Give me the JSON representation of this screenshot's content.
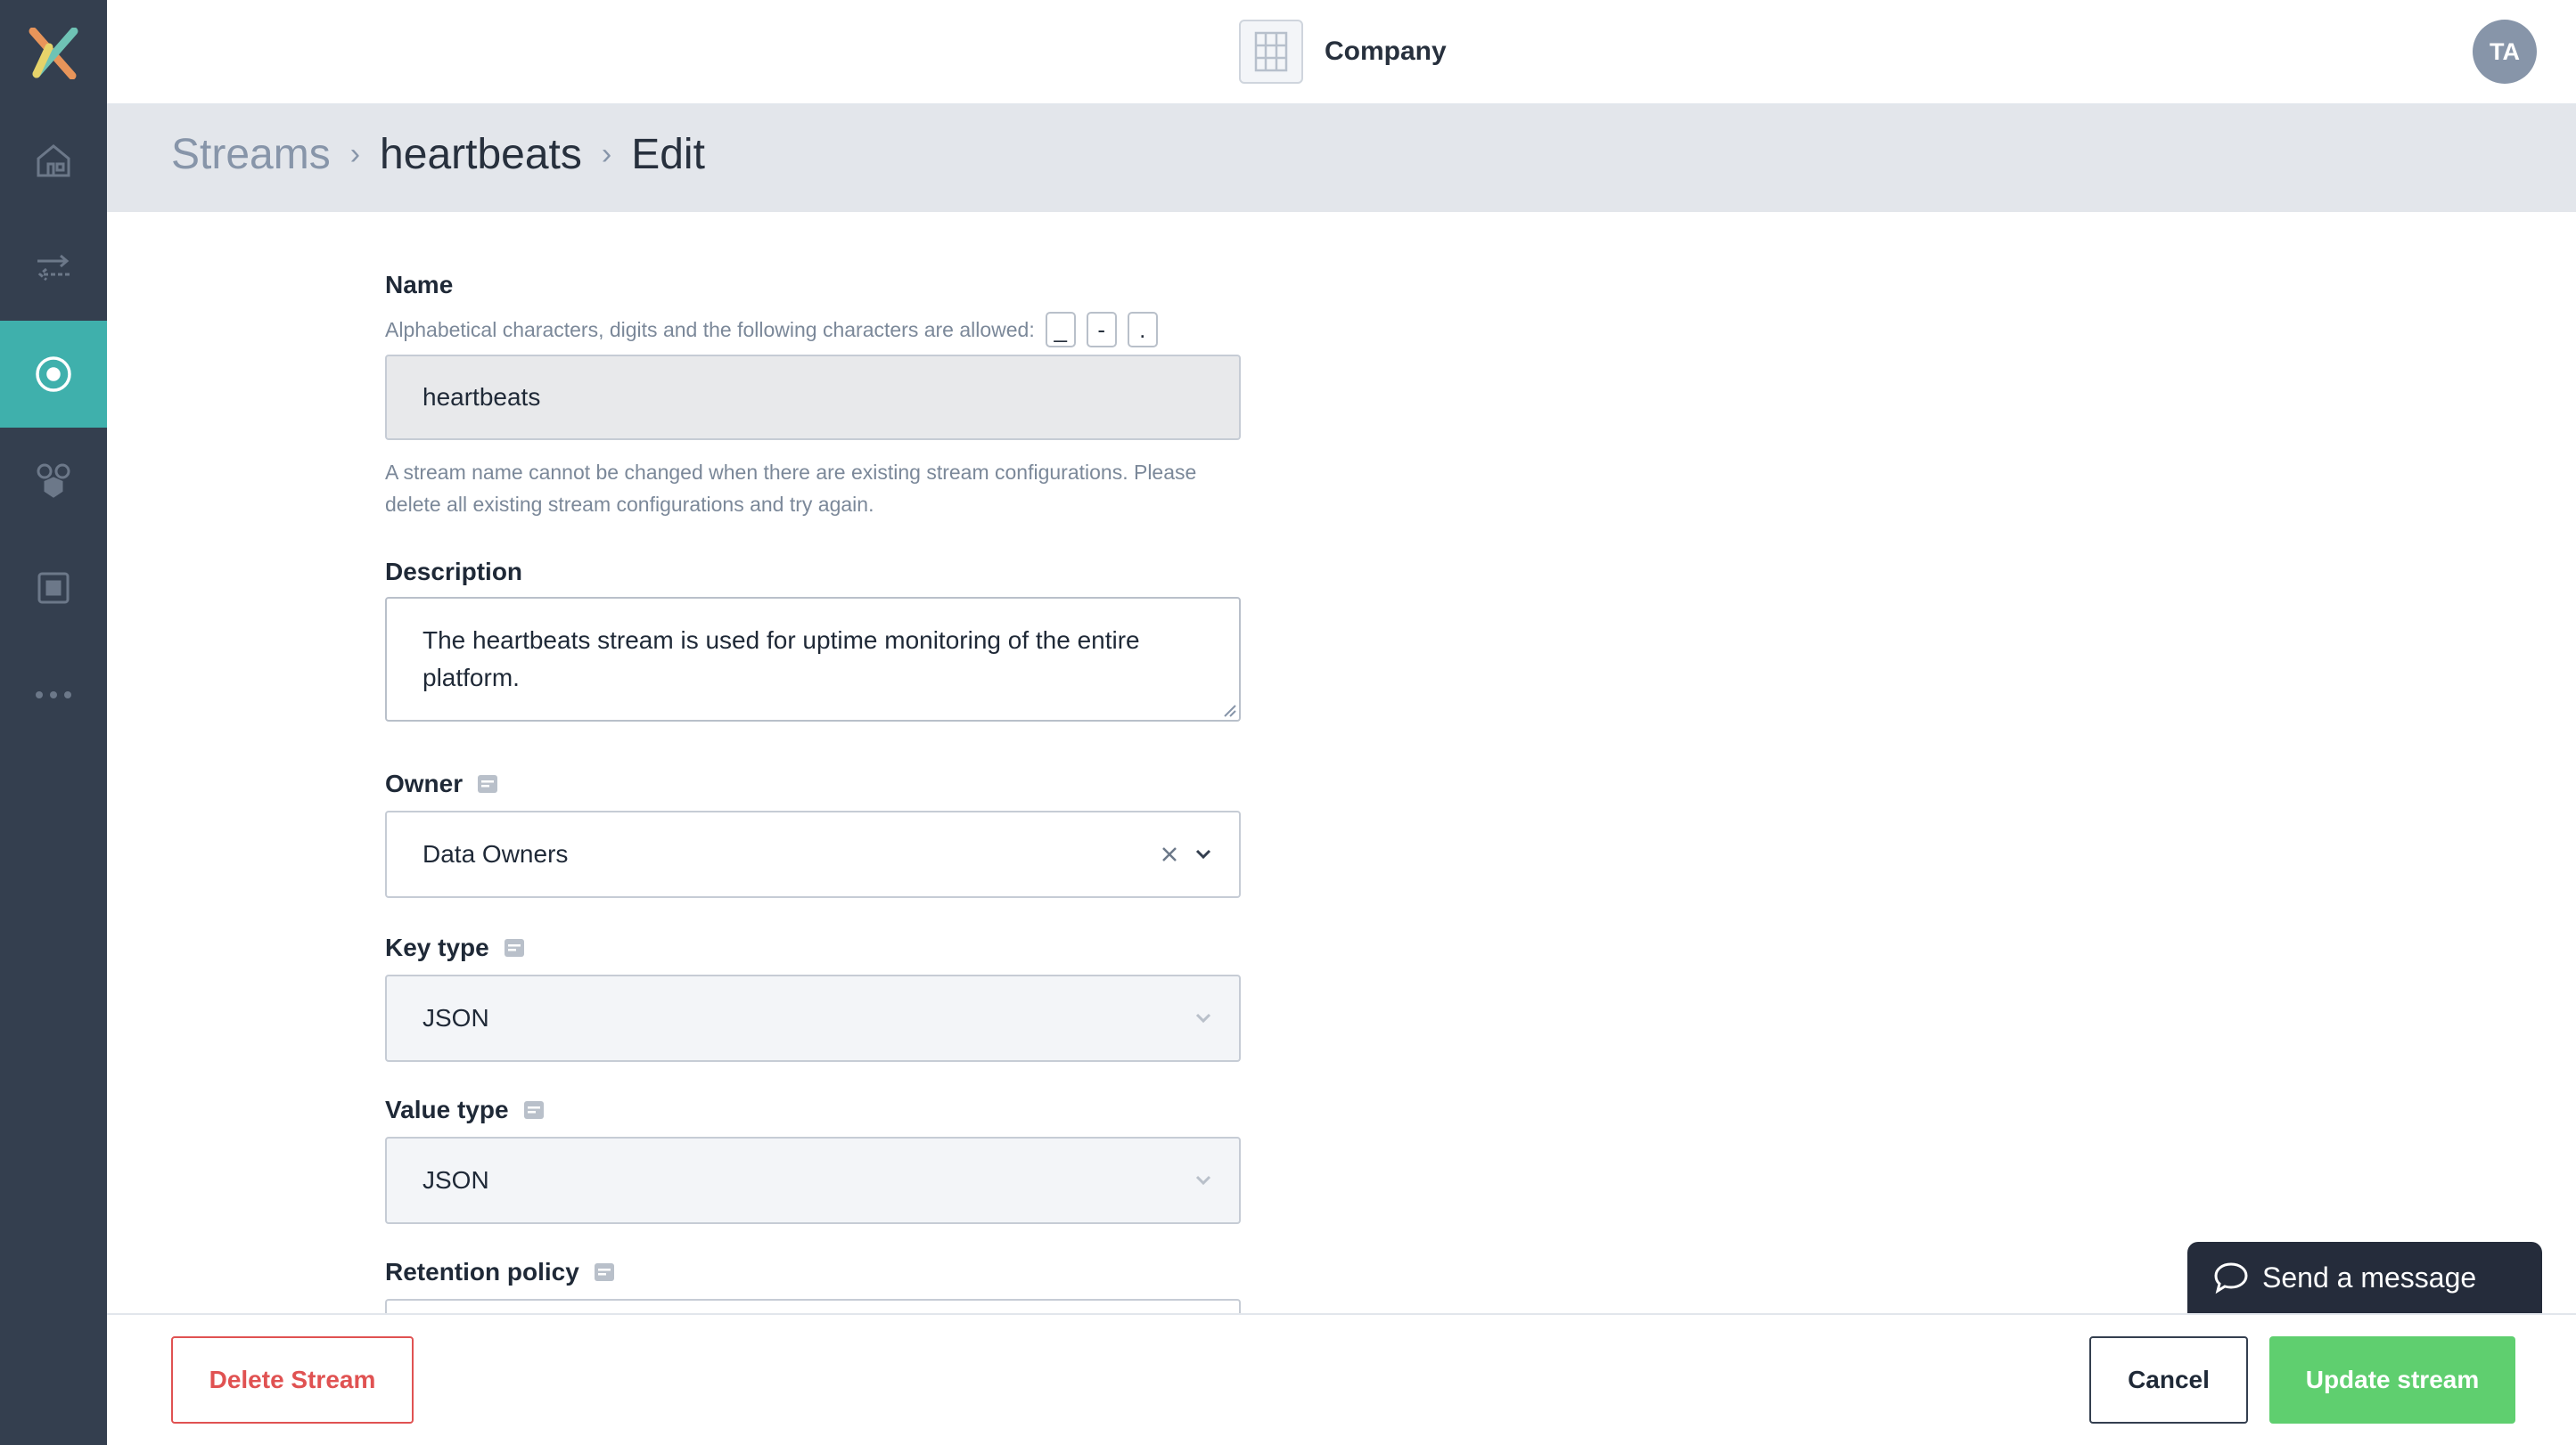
{
  "nav": {
    "items": [
      {
        "icon": "home-icon"
      },
      {
        "icon": "transfer-arrows-icon"
      },
      {
        "icon": "stream-target-icon",
        "active": true
      },
      {
        "icon": "connectors-icon"
      },
      {
        "icon": "box-icon"
      },
      {
        "icon": "more-dots-icon"
      }
    ]
  },
  "header": {
    "company_name": "Company",
    "avatar_initials": "TA"
  },
  "breadcrumb": {
    "root": "Streams",
    "stream": "heartbeats",
    "current": "Edit"
  },
  "form": {
    "name": {
      "label": "Name",
      "allowed_help": "Alphabetical characters, digits and the following characters are allowed:",
      "allowed_chars": [
        "_",
        "-",
        "."
      ],
      "value": "heartbeats",
      "locked_help": "A stream name cannot be changed when there are existing stream configurations. Please delete all existing stream configurations and try again."
    },
    "description": {
      "label": "Description",
      "value": "The heartbeats stream is used for uptime monitoring of the entire platform."
    },
    "owner": {
      "label": "Owner",
      "value": "Data Owners"
    },
    "key_type": {
      "label": "Key type",
      "value": "JSON"
    },
    "value_type": {
      "label": "Value type",
      "value": "JSON"
    },
    "retention_policy": {
      "label": "Retention policy"
    }
  },
  "footer": {
    "delete_label": "Delete Stream",
    "cancel_label": "Cancel",
    "update_label": "Update stream"
  },
  "chat": {
    "label": "Send a message"
  },
  "colors": {
    "sidebar": "#343f4f",
    "active": "#3fb0ac",
    "danger": "#e05252",
    "success": "#5fcf6f"
  }
}
